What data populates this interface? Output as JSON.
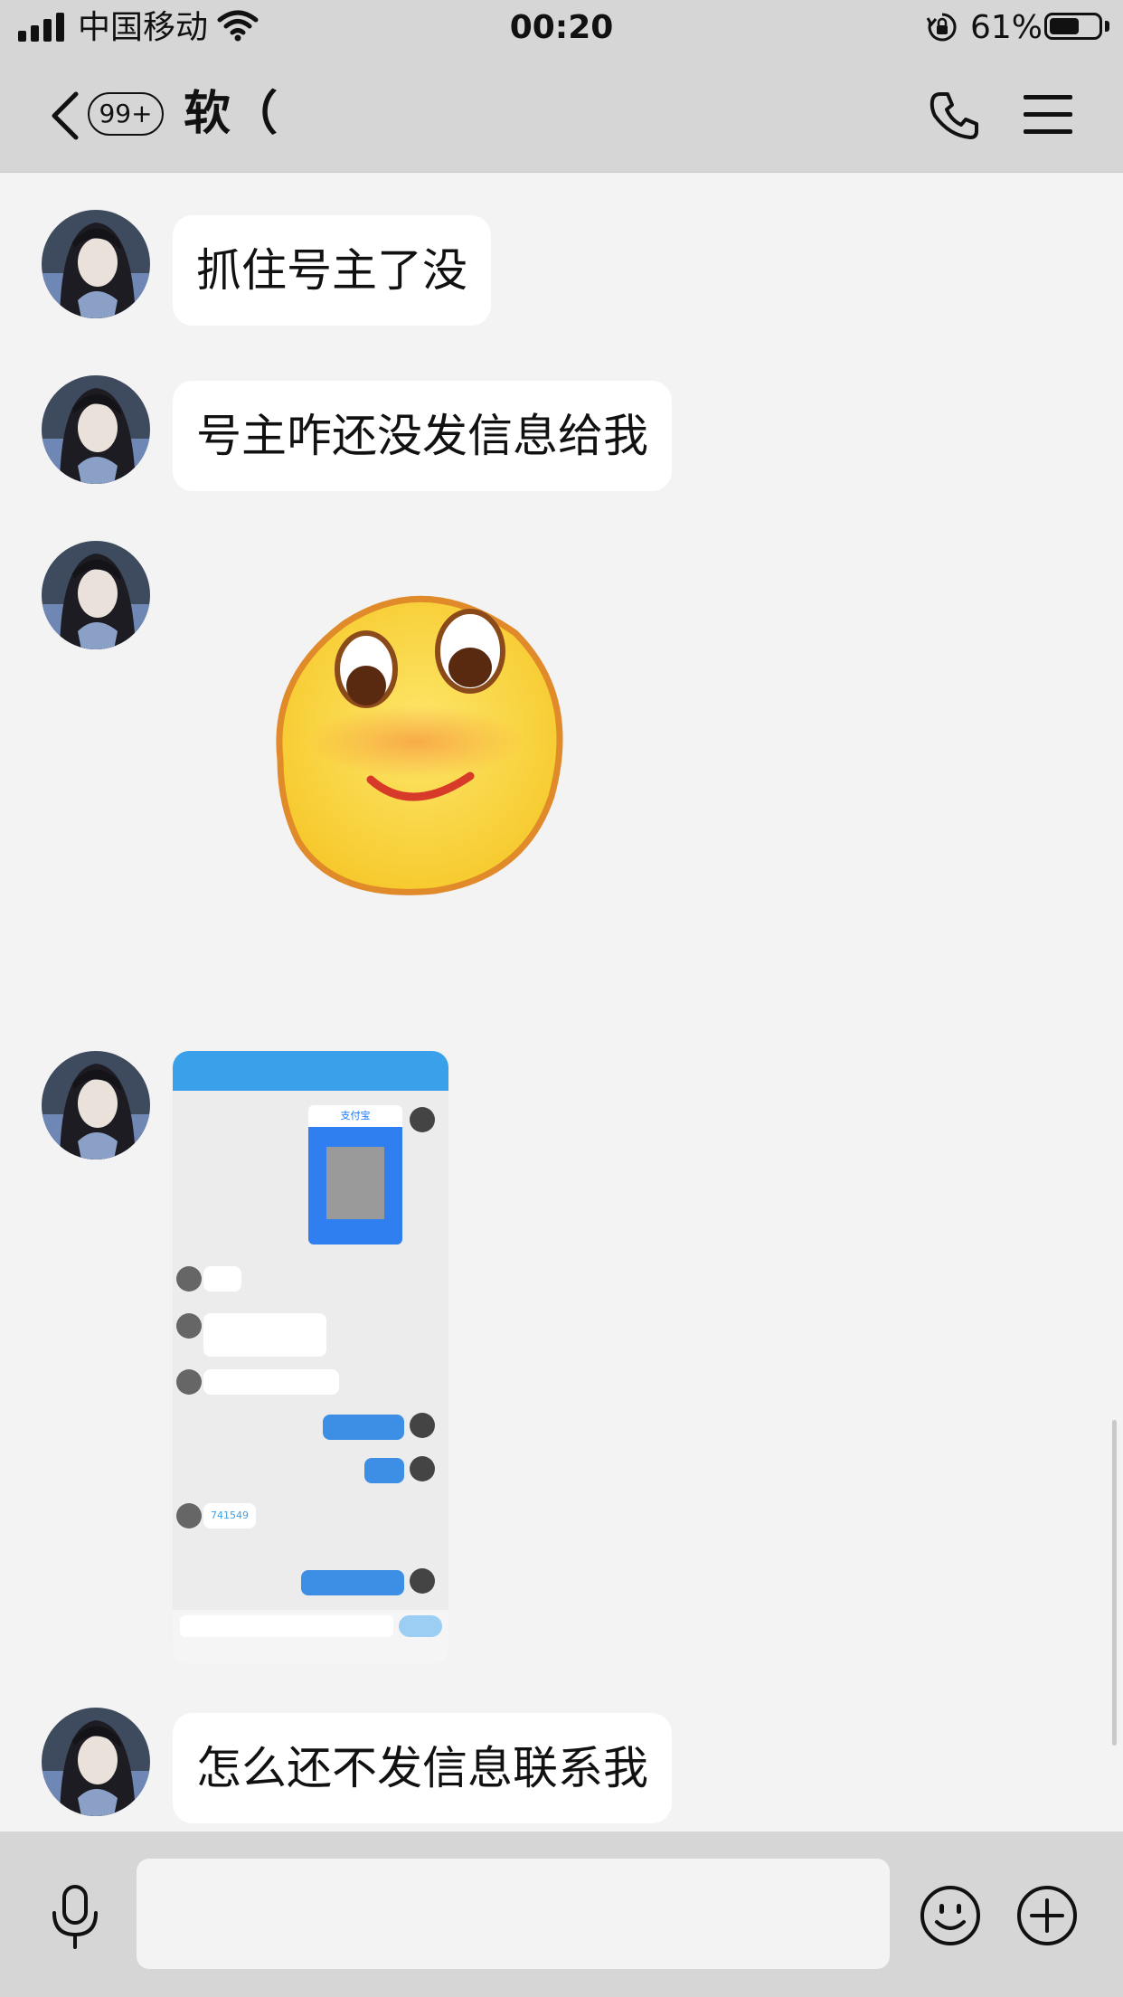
{
  "status_bar": {
    "carrier": "中国移动",
    "time": "00:20",
    "battery_percent": "61%",
    "battery_level": 0.61,
    "signal_bars": 4
  },
  "nav": {
    "unread_badge": "99+",
    "title": "软（"
  },
  "messages": [
    {
      "type": "text",
      "text": "抓住号主了没"
    },
    {
      "type": "text",
      "text": "号主咋还没发信息给我"
    },
    {
      "type": "sticker",
      "icon": "smiling-face-sticker"
    },
    {
      "type": "image",
      "icon": "chat-screenshot-image"
    },
    {
      "type": "text",
      "text": "怎么还不发信息联系我"
    }
  ],
  "screenshot_msg": {
    "alipay_label": "支付宝",
    "code_label": "741549"
  },
  "input": {
    "placeholder": ""
  },
  "colors": {
    "bar_bg": "#d6d6d6",
    "chat_bg": "#f3f3f3",
    "bubble_bg": "#ffffff",
    "mini_accent": "#3aa0ea"
  }
}
